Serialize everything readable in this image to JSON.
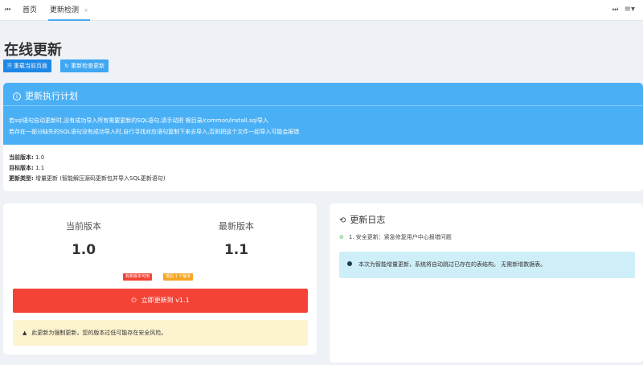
{
  "tabs": {
    "items": [
      {
        "label": "首页"
      },
      {
        "label": "更新检测",
        "active": true
      }
    ],
    "close_glyph": "×"
  },
  "page": {
    "title": "在线更新",
    "buttons": {
      "reload": "重载当前页面",
      "check": "重新检查更新"
    }
  },
  "plan": {
    "title": "更新执行计划",
    "lines": [
      "若sql语句自动更新时,没有成功导入所有需要更新的SQL语句,请手动把 根目录/common/install.sql导入",
      "若存在一部分缺失的SQL语句没有成功导入时,自行寻找对应语句复制下来去导入,否则把这个文件一起导入可能会报错"
    ],
    "current_label": "当前版本:",
    "current_value": "1.0",
    "target_label": "目标版本:",
    "target_value": "1.1",
    "type_label": "更新类型:",
    "type_value": "增量更新 (智能解压源码更新包并导入SQL更新语句)"
  },
  "version": {
    "current_label": "当前版本",
    "current_value": "1.0",
    "latest_label": "最新版本",
    "latest_value": "1.1",
    "badge_available": "有新版本可用",
    "badge_behind": "落后 1 个版本",
    "update_button": "立即更新到 v1.1",
    "warning": "此更新为强制更新，您的版本过低可能存在安全风险。"
  },
  "changelog": {
    "title": "更新日志",
    "items": [
      "1. 安全更新：紧急修复用户中心报错问题"
    ],
    "info": "本次为智能增量更新，系统将自动跳过已存在的表结构。 无需新增数据表。"
  },
  "colors": {
    "accent": "#4ab0f5",
    "danger": "#f44336",
    "warning_bg": "#fdf3cf",
    "info_bg": "#cfeff8",
    "badge_available": "#f44336",
    "badge_behind": "#f5a623"
  }
}
